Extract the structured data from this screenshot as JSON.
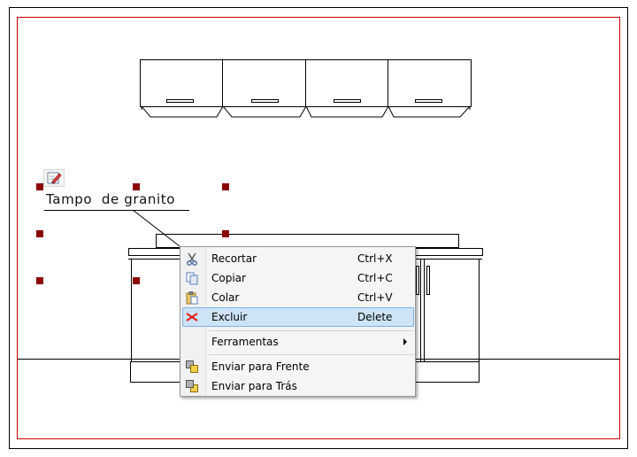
{
  "drawing": {
    "note_label": "Tampo  de granito"
  },
  "colors": {
    "frame_border": "#cc0000",
    "selection_handle": "#8b0000",
    "highlight_fill": "#cde4f7",
    "highlight_border": "#7fb0de"
  },
  "context_menu": {
    "items": [
      {
        "label": "Recortar",
        "shortcut": "Ctrl+X",
        "icon": "scissors-icon"
      },
      {
        "label": "Copiar",
        "shortcut": "Ctrl+C",
        "icon": "copy-icon"
      },
      {
        "label": "Colar",
        "shortcut": "Ctrl+V",
        "icon": "paste-icon"
      },
      {
        "label": "Excluir",
        "shortcut": "Delete",
        "icon": "delete-x-icon",
        "highlighted": true
      },
      {
        "label": "Ferramentas",
        "shortcut": "",
        "icon": "",
        "submenu": true
      },
      {
        "label": "Enviar para Frente",
        "shortcut": "",
        "icon": "bring-front-icon"
      },
      {
        "label": "Enviar para Trás",
        "shortcut": "",
        "icon": "send-back-icon"
      }
    ]
  }
}
